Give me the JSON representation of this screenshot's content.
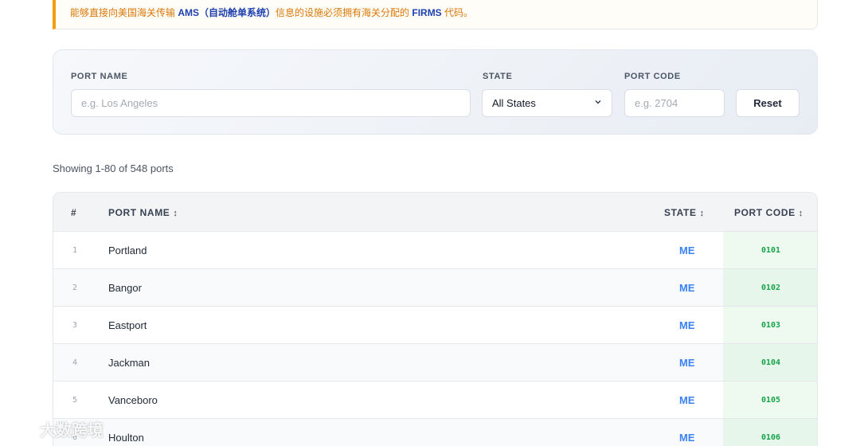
{
  "notice": {
    "prefix": "能够直接向美国海关传输 ",
    "ams": "AMS（自动舱单系统）",
    "middle": "信息的设施必须拥有海关分配的 ",
    "firms": "FIRMS",
    "suffix": " 代码。"
  },
  "filters": {
    "port_name_label": "PORT NAME",
    "port_name_placeholder": "e.g. Los Angeles",
    "state_label": "STATE",
    "state_selected": "All States",
    "port_code_label": "PORT CODE",
    "port_code_placeholder": "e.g. 2704",
    "reset_label": "Reset"
  },
  "summary": "Showing 1-80 of 548 ports",
  "table": {
    "headers": {
      "num": "#",
      "port_name": "PORT NAME",
      "state": "STATE",
      "port_code": "PORT CODE",
      "sort_glyph": "↕"
    },
    "rows": [
      {
        "num": "1",
        "name": "Portland",
        "state": "ME",
        "code": "0101"
      },
      {
        "num": "2",
        "name": "Bangor",
        "state": "ME",
        "code": "0102"
      },
      {
        "num": "3",
        "name": "Eastport",
        "state": "ME",
        "code": "0103"
      },
      {
        "num": "4",
        "name": "Jackman",
        "state": "ME",
        "code": "0104"
      },
      {
        "num": "5",
        "name": "Vanceboro",
        "state": "ME",
        "code": "0105"
      },
      {
        "num": "6",
        "name": "Houlton",
        "state": "ME",
        "code": "0106"
      }
    ]
  },
  "watermark": {
    "text": "大数跨境",
    "icon": "brand-logo-icon"
  },
  "colors": {
    "notice_accent": "#f59e0b",
    "link_blue": "#1e40af",
    "state_blue": "#3b82f6",
    "code_green": "#16a34a"
  }
}
